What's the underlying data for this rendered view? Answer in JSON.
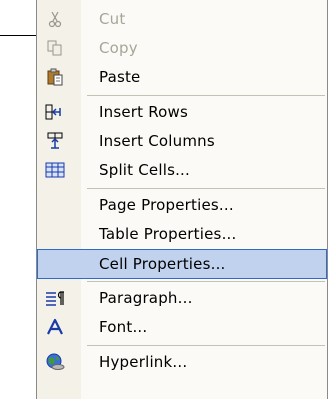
{
  "menu": {
    "items": [
      {
        "label": "Cut",
        "icon": "scissors-icon",
        "disabled": true
      },
      {
        "label": "Copy",
        "icon": "copy-icon",
        "disabled": true
      },
      {
        "label": "Paste",
        "icon": "paste-icon",
        "disabled": false
      },
      {
        "label": "Insert Rows",
        "icon": "insert-rows-icon",
        "disabled": false
      },
      {
        "label": "Insert Columns",
        "icon": "insert-columns-icon",
        "disabled": false
      },
      {
        "label": "Split Cells...",
        "icon": "split-cells-icon",
        "disabled": false
      },
      {
        "label": "Page Properties...",
        "icon": "",
        "disabled": false
      },
      {
        "label": "Table Properties...",
        "icon": "",
        "disabled": false
      },
      {
        "label": "Cell Properties...",
        "icon": "",
        "disabled": false,
        "highlighted": true
      },
      {
        "label": "Paragraph...",
        "icon": "paragraph-icon",
        "disabled": false
      },
      {
        "label": "Font...",
        "icon": "font-icon",
        "disabled": false
      },
      {
        "label": "Hyperlink...",
        "icon": "hyperlink-globe-icon",
        "disabled": false
      }
    ]
  },
  "colors": {
    "highlight_fill": "#c1d2ee",
    "highlight_border": "#316ac5",
    "disabled_text": "#a8a597"
  }
}
